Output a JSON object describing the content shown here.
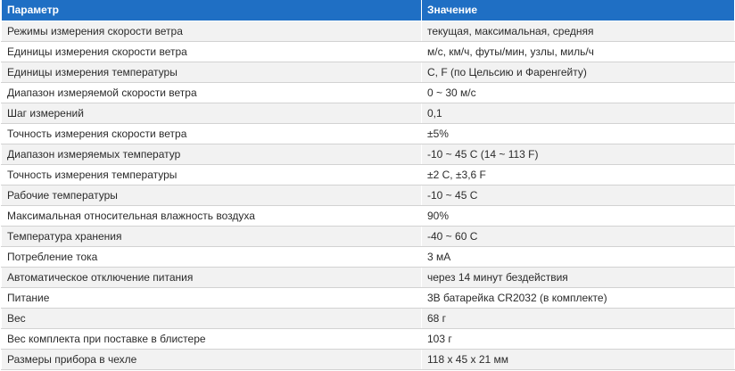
{
  "table": {
    "headers": [
      "Параметр",
      "Значение"
    ],
    "rows": [
      [
        "Режимы измерения скорости ветра",
        "текущая, максимальная, средняя"
      ],
      [
        "Единицы измерения скорости ветра",
        "м/с, км/ч, футы/мин, узлы, миль/ч"
      ],
      [
        "Единицы измерения температуры",
        "C, F (по Цельсию и Фаренгейту)"
      ],
      [
        "Диапазон измеряемой скорости ветра",
        "0 ~ 30 м/с"
      ],
      [
        "Шаг измерений",
        "0,1"
      ],
      [
        "Точность измерения скорости ветра",
        "±5%"
      ],
      [
        "Диапазон измеряемых температур",
        "-10 ~ 45 C (14 ~ 113 F)"
      ],
      [
        "Точность измерения температуры",
        "±2 C, ±3,6 F"
      ],
      [
        "Рабочие температуры",
        "-10 ~ 45 C"
      ],
      [
        "Максимальная относительная влажность воздуха",
        "90%"
      ],
      [
        "Температура хранения",
        "-40 ~ 60 C"
      ],
      [
        "Потребление тока",
        "3 мА"
      ],
      [
        "Автоматическое отключение питания",
        "через 14 минут бездействия"
      ],
      [
        "Питание",
        "3В батарейка CR2032 (в комплекте)"
      ],
      [
        "Вес",
        "68 г"
      ],
      [
        "Вес комплекта при поставке в блистере",
        "103 г"
      ],
      [
        "Размеры прибора в чехле",
        "118 x 45 x 21 мм"
      ]
    ]
  }
}
